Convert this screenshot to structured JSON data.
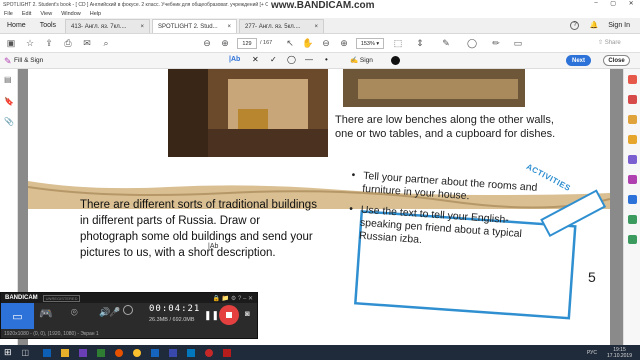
{
  "window": {
    "title": "SPOTLIGHT 2. Student's book - [ CD ] Английский в фокусе. 2 класс. Учебник для общеобразоват. учреждений [+ CD] - Adobe Acrobat Reader DC",
    "watermark": "www.BANDICAM.com"
  },
  "menu": [
    "File",
    "Edit",
    "View",
    "Window",
    "Help"
  ],
  "tabs": {
    "home": "Home",
    "tools": "Tools",
    "docs": [
      {
        "label": "413- Англ. яз. 7кл....",
        "close": "×"
      },
      {
        "label": "SPOTLIGHT 2. Stud...",
        "close": "×"
      },
      {
        "label": "277- Англ. яз. 5кл....",
        "close": "×"
      }
    ],
    "help": "?",
    "bell": "🔔",
    "signin": "Sign In"
  },
  "toolbar": {
    "page_current": "129",
    "page_total": "/ 167",
    "zoom": "153%",
    "share": "Share"
  },
  "fillsign": {
    "label": "Fill & Sign",
    "text_tool": "|Ab",
    "sign": "Sign",
    "next": "Next",
    "close": "Close"
  },
  "book": {
    "caption_right": "There are low benches along the other walls, one or two tables, and a cupboard for dishes.",
    "para_left": "There are different sorts of traditional buildings in different parts of Russia. Draw or photograph some old buildings and send your pictures to us, with a short description.",
    "cursor_label": "|Ab",
    "activities_title": "ACTIVITIES",
    "activities": [
      "Tell your partner about the rooms and furniture in your house.",
      "Use the text to tell your English-speaking pen friend about a typical Russian izba."
    ],
    "page_number": "5"
  },
  "bandicam": {
    "brand": "BANDICAM",
    "unregistered": "UNREGISTERED",
    "time": "00:04:21",
    "size": "26.3MB / 692.0MB",
    "resolution": "1920x1080 - (0, 0), (1920, 1080) - Экран 1"
  },
  "taskbar": {
    "lang": "РУС",
    "time": "19:15",
    "date": "17.10.2019"
  },
  "colors": {
    "accent": "#2d72d9",
    "activities": "#2f8fd0",
    "page_shadow": "#8a8a8a"
  }
}
